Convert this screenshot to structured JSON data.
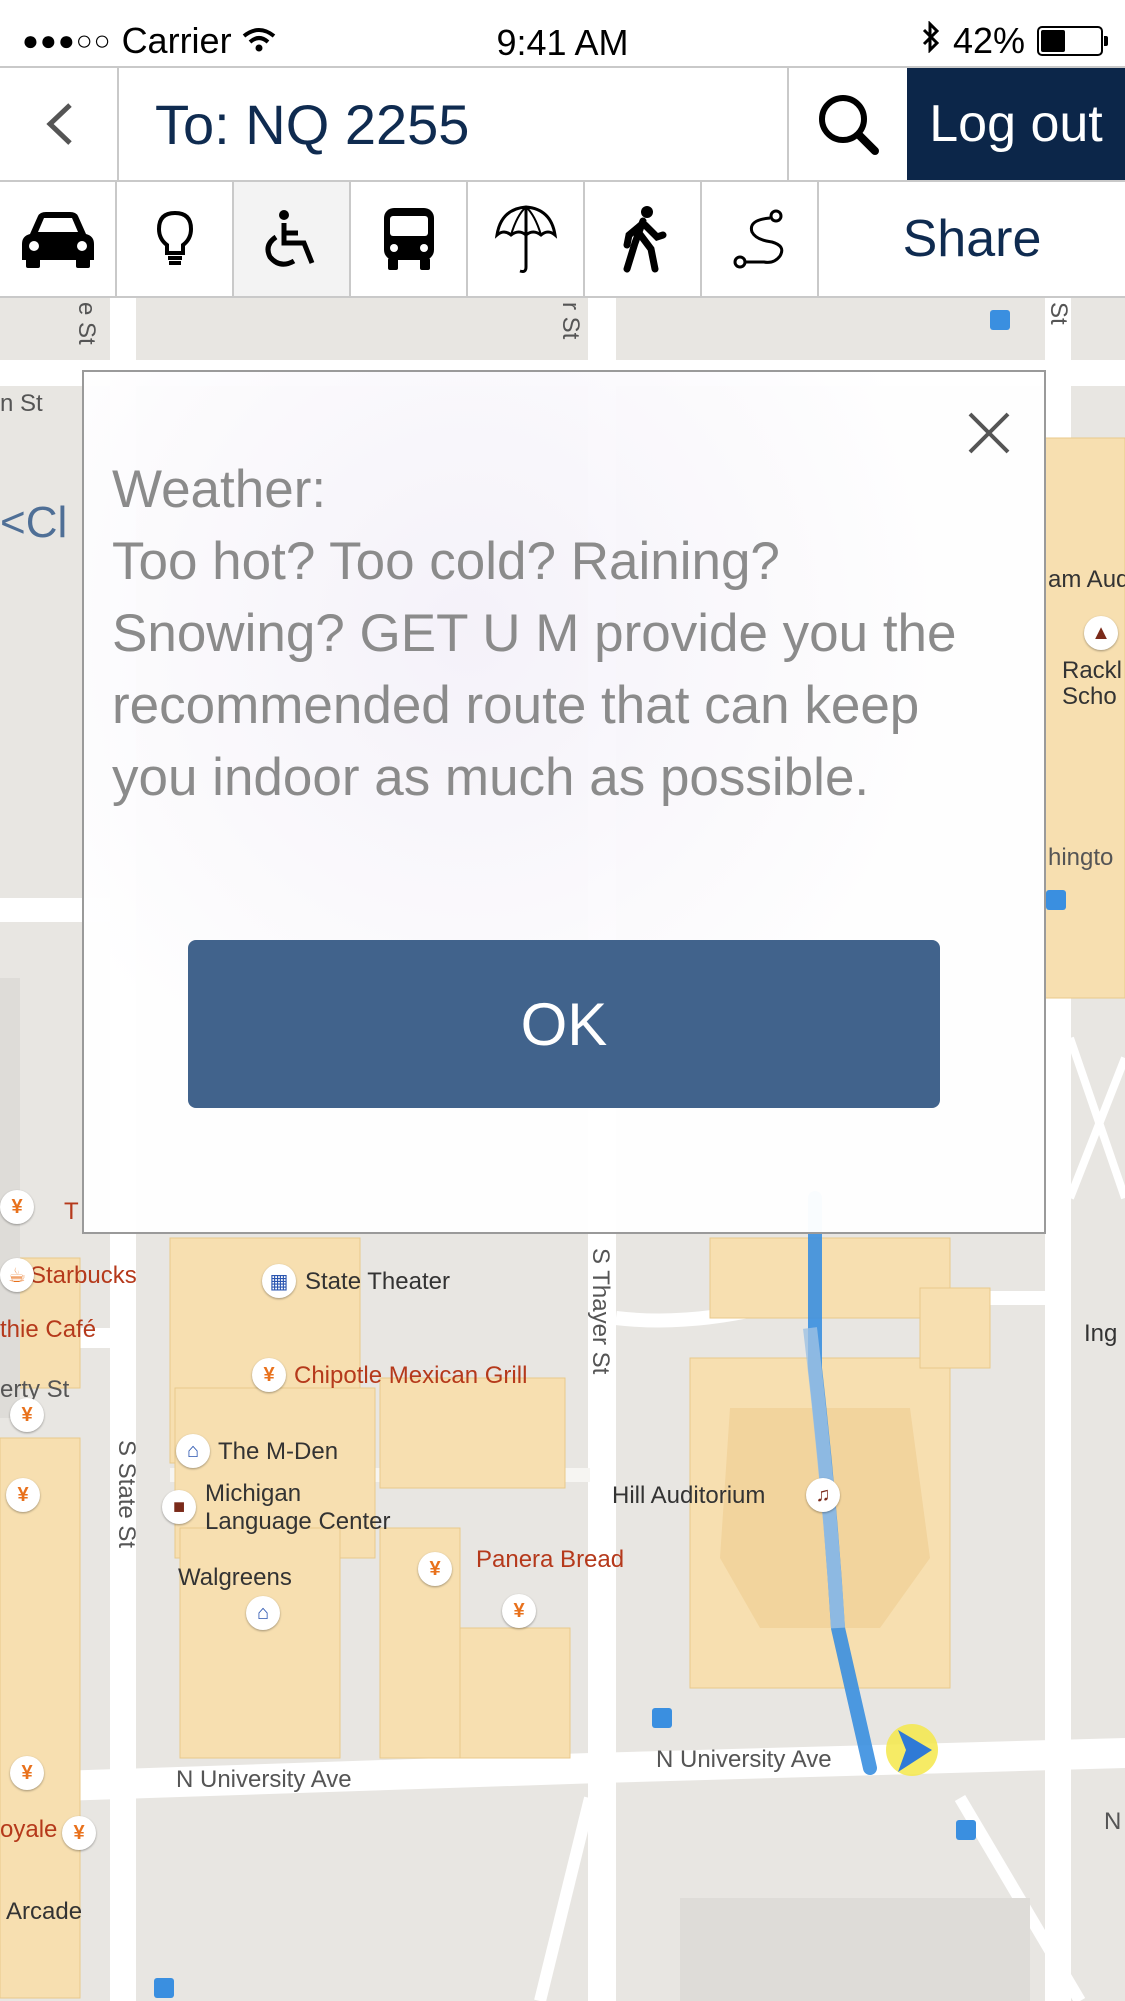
{
  "status_bar": {
    "carrier": "Carrier",
    "time": "9:41 AM",
    "battery_text": "42%",
    "battery_level": 0.42
  },
  "top_bar": {
    "destination": "To: NQ 2255",
    "logout_label": "Log out"
  },
  "mode_bar": {
    "icons": [
      "car-icon",
      "lightbulb-icon",
      "wheelchair-icon",
      "bus-icon",
      "umbrella-icon",
      "walking-icon",
      "route-icon"
    ],
    "share_label": "Share"
  },
  "map": {
    "labels": {
      "starbucks": "Starbucks",
      "state_theater": "State Theater",
      "chipotle": "Chipotle Mexican Grill",
      "m_den": "The M-Den",
      "mlc": "Michigan\nLanguage Center",
      "walgreens": "Walgreens",
      "panera": "Panera Bread",
      "hill_auditorium": "Hill Auditorium",
      "n_university_1": "N University Ave",
      "n_university_2": "N University Ave",
      "s_state": "S State St",
      "s_thayer": "S Thayer St",
      "arcade": "Arcade",
      "erty_st": "erty St",
      "thie_cafe": "thie Café",
      "oyale": "oyale",
      "n_st": "n St",
      "ham_aud": "am Aud",
      "rackham": "Rackl\nScho",
      "hingto": "hingto",
      "ing": "Ing",
      "ci_partial": "<Cl",
      "t_partial": "T",
      "n_right": "N",
      "e_st_top": "e St",
      "r_st_top": "r St",
      "st_top_right": "St"
    },
    "route_color": "#3a8fe0"
  },
  "modal": {
    "heading": "Weather:",
    "body": "Too hot? Too cold? Raining? Snowing? GET U M provide you the recommended route that can keep you indoor as much as possible.",
    "ok_label": "OK"
  }
}
